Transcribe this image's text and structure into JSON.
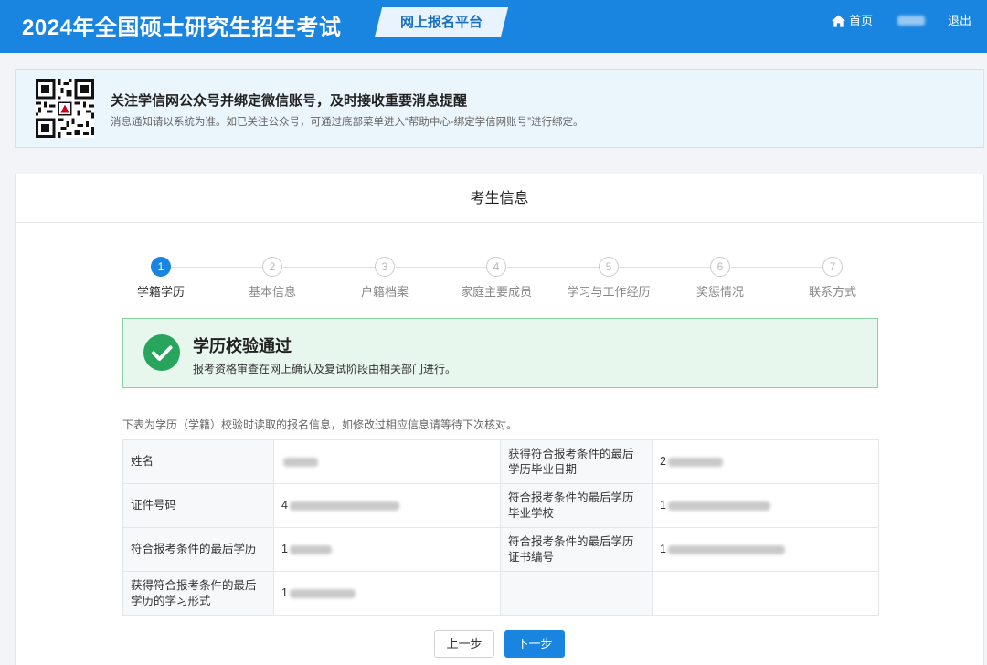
{
  "header": {
    "site_title": "2024年全国硕士研究生招生考试",
    "platform_label": "网上报名平台",
    "home_label": "首页",
    "logout_label": "退出"
  },
  "notice": {
    "title": "关注学信网公众号并绑定微信账号，及时接收重要消息提醒",
    "subtitle": "消息通知请以系统为准。如已关注公众号，可通过底部菜单进入“帮助中心-绑定学信网账号”进行绑定。"
  },
  "card": {
    "title": "考生信息"
  },
  "steps": [
    {
      "num": "1",
      "label": "学籍学历"
    },
    {
      "num": "2",
      "label": "基本信息"
    },
    {
      "num": "3",
      "label": "户籍档案"
    },
    {
      "num": "4",
      "label": "家庭主要成员"
    },
    {
      "num": "5",
      "label": "学习与工作经历"
    },
    {
      "num": "6",
      "label": "奖惩情况"
    },
    {
      "num": "7",
      "label": "联系方式"
    }
  ],
  "success": {
    "title": "学历校验通过",
    "subtitle": "报考资格审查在网上确认及复试阶段由相关部门进行。"
  },
  "table_note": "下表为学历（学籍）校验时读取的报名信息，如修改过相应信息请等待下次核对。",
  "info_table": {
    "rows": [
      {
        "label_left": "姓名",
        "value_left": "",
        "label_right": "获得符合报考条件的最后学历毕业日期",
        "value_right": "2"
      },
      {
        "label_left": "证件号码",
        "value_left": "4",
        "label_right": "符合报考条件的最后学历毕业学校",
        "value_right": "1"
      },
      {
        "label_left": "符合报考条件的最后学历",
        "value_left": "1",
        "label_right": "符合报考条件的最后学历证书编号",
        "value_right": "1"
      },
      {
        "label_left": "获得符合报考条件的最后学历的学习形式",
        "value_left": "1",
        "label_right": "",
        "value_right": ""
      }
    ]
  },
  "buttons": {
    "prev_label": "上一步",
    "next_label": "下一步"
  },
  "colors": {
    "primary": "#1a85e0",
    "success": "#28a55c",
    "success_bg": "#e8f7ee"
  },
  "icons": {
    "home": "home-icon",
    "qr": "qr-code-icon",
    "check": "check-circle-icon"
  }
}
